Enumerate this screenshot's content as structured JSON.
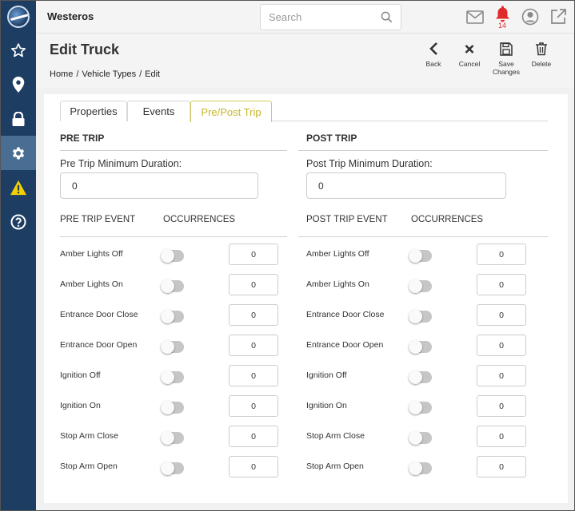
{
  "app": {
    "name": "Westeros"
  },
  "search": {
    "placeholder": "Search"
  },
  "notifications": {
    "count": "14"
  },
  "page": {
    "title": "Edit Truck",
    "breadcrumb": [
      "Home",
      "/",
      "Vehicle Types",
      "/",
      "Edit"
    ]
  },
  "actions": {
    "back": "Back",
    "cancel": "Cancel",
    "save_line1": "Save",
    "save_line2": "Changes",
    "delete": "Delete"
  },
  "tabs": [
    "Properties",
    "Events",
    "Pre/Post Trip"
  ],
  "active_tab": "Pre/Post Trip",
  "pre_trip": {
    "title": "PRE TRIP",
    "min_duration_label": "Pre Trip Minimum Duration:",
    "min_duration_value": "0",
    "event_header": "PRE TRIP EVENT",
    "occ_header": "OCCURRENCES",
    "events": [
      {
        "label": "Amber Lights Off",
        "enabled": false,
        "occurrences": "0"
      },
      {
        "label": "Amber Lights On",
        "enabled": false,
        "occurrences": "0"
      },
      {
        "label": "Entrance Door Close",
        "enabled": false,
        "occurrences": "0"
      },
      {
        "label": "Entrance Door Open",
        "enabled": false,
        "occurrences": "0"
      },
      {
        "label": "Ignition Off",
        "enabled": false,
        "occurrences": "0"
      },
      {
        "label": "Ignition On",
        "enabled": false,
        "occurrences": "0"
      },
      {
        "label": "Stop Arm Close",
        "enabled": false,
        "occurrences": "0"
      },
      {
        "label": "Stop Arm Open",
        "enabled": false,
        "occurrences": "0"
      }
    ]
  },
  "post_trip": {
    "title": "POST TRIP",
    "min_duration_label": "Post Trip Minimum Duration:",
    "min_duration_value": "0",
    "event_header": "POST TRIP EVENT",
    "occ_header": "OCCURRENCES",
    "events": [
      {
        "label": "Amber Lights Off",
        "enabled": false,
        "occurrences": "0"
      },
      {
        "label": "Amber Lights On",
        "enabled": false,
        "occurrences": "0"
      },
      {
        "label": "Entrance Door Close",
        "enabled": false,
        "occurrences": "0"
      },
      {
        "label": "Entrance Door Open",
        "enabled": false,
        "occurrences": "0"
      },
      {
        "label": "Ignition Off",
        "enabled": false,
        "occurrences": "0"
      },
      {
        "label": "Ignition On",
        "enabled": false,
        "occurrences": "0"
      },
      {
        "label": "Stop Arm Close",
        "enabled": false,
        "occurrences": "0"
      },
      {
        "label": "Stop Arm Open",
        "enabled": false,
        "occurrences": "0"
      }
    ]
  },
  "colors": {
    "sidebar": "#1d3d63",
    "sidebar_active": "#4a6e93",
    "active_tab": "#c6b62a",
    "alert": "#e02b2b",
    "warning": "#f5d000"
  },
  "sidebar_icons": [
    "star-icon",
    "map-pin-icon",
    "lock-icon",
    "gear-icon",
    "warning-icon",
    "help-icon"
  ]
}
